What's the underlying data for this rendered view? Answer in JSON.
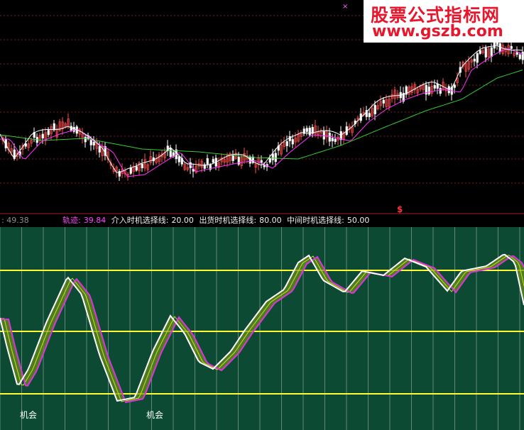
{
  "watermark": {
    "title": "股票公式指标网",
    "url": "www.gszb.com"
  },
  "info_bar": {
    "left_value": ": 49.38",
    "track_label": "轨迹:",
    "track_value": "39.84",
    "entry_label": "介入时机选择线:",
    "entry_value": "20.00",
    "exit_label": "出货时机选择线:",
    "exit_value": "80.00",
    "mid_label": "中间时机选择线:",
    "mid_value": "50.00"
  },
  "signal_marker": "$",
  "opportunity_labels": [
    "机会",
    "机会"
  ],
  "colors": {
    "price_bg": "#000000",
    "indicator_bg": "#0c4a33",
    "grid": "#7a2020",
    "up_candle": "#ff4d4d",
    "down_candle": "#ffffff",
    "ma_white": "#ffffff",
    "ma_magenta": "#ff33ff",
    "ma_green": "#33cc33",
    "threshold": "#ffff33",
    "track_white": "#ffffff",
    "track_magenta": "#dd33dd",
    "ribbon": "#ccdd22"
  },
  "chart_data": {
    "type": "line",
    "levels": [
      20,
      50,
      80
    ]
  }
}
